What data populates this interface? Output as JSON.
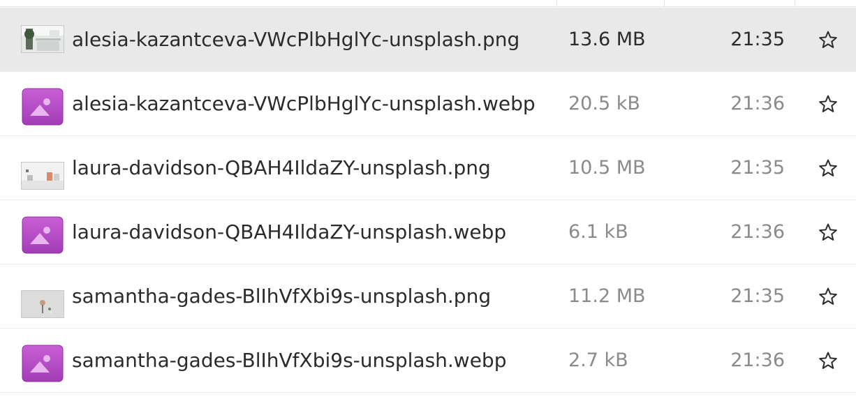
{
  "files": [
    {
      "name": "alesia-kazantceva-VWcPlbHglYc-unsplash.png",
      "size": "13.6 MB",
      "modified": "21:35",
      "icon": "image-thumbnail",
      "selected": true
    },
    {
      "name": "alesia-kazantceva-VWcPlbHglYc-unsplash.webp",
      "size": "20.5 kB",
      "modified": "21:36",
      "icon": "image-file-icon",
      "selected": false
    },
    {
      "name": "laura-davidson-QBAH4IldaZY-unsplash.png",
      "size": "10.5 MB",
      "modified": "21:35",
      "icon": "image-thumbnail",
      "selected": false
    },
    {
      "name": "laura-davidson-QBAH4IldaZY-unsplash.webp",
      "size": "6.1 kB",
      "modified": "21:36",
      "icon": "image-file-icon",
      "selected": false
    },
    {
      "name": "samantha-gades-BlIhVfXbi9s-unsplash.png",
      "size": "11.2 MB",
      "modified": "21:35",
      "icon": "image-thumbnail",
      "selected": false
    },
    {
      "name": "samantha-gades-BlIhVfXbi9s-unsplash.webp",
      "size": "2.7 kB",
      "modified": "21:36",
      "icon": "image-file-icon",
      "selected": false
    }
  ],
  "colors": {
    "selected_row_bg": "#e9e9e9",
    "image_icon_purple": "#b548c6",
    "secondary_text": "#8a8a8a",
    "primary_text": "#2b2b2b"
  }
}
